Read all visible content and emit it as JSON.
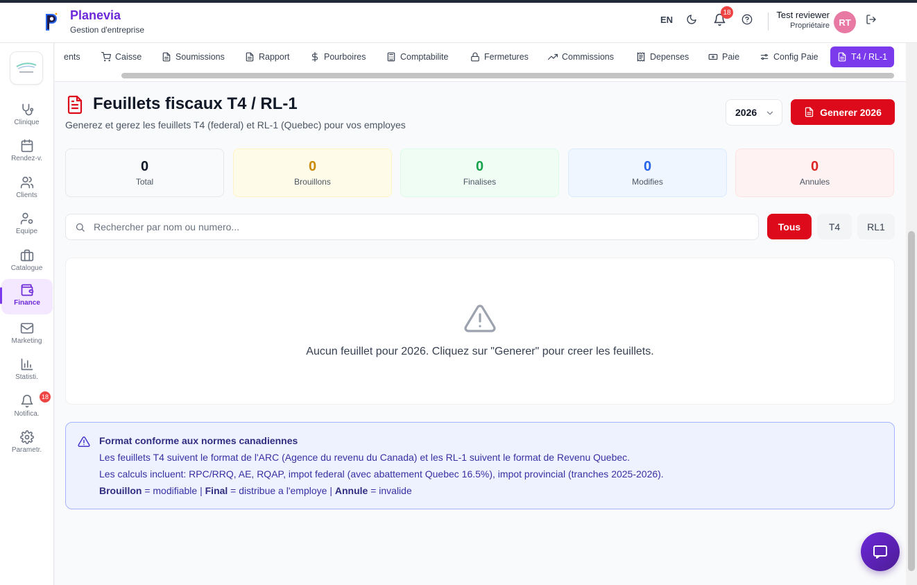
{
  "app": {
    "brand_title": "Planevia",
    "brand_subtitle": "Gestion d'entreprise",
    "accent_color": "#7c3aed",
    "danger_color": "#dc0a1a"
  },
  "header": {
    "lang": "EN",
    "notifications_count": "18",
    "user_name": "Test reviewer",
    "user_role": "Propriétaire",
    "avatar_initials": "RT"
  },
  "sidebar": {
    "items": [
      {
        "label": "Clinique",
        "icon": "stethoscope-icon"
      },
      {
        "label": "Rendez-v.",
        "icon": "calendar-icon"
      },
      {
        "label": "Clients",
        "icon": "users-icon"
      },
      {
        "label": "Equipe",
        "icon": "user-cog-icon"
      },
      {
        "label": "Catalogue",
        "icon": "briefcase-icon"
      },
      {
        "label": "Finance",
        "icon": "wallet-icon",
        "active": true
      },
      {
        "label": "Marketing",
        "icon": "mail-icon"
      },
      {
        "label": "Statisti.",
        "icon": "bar-chart-icon"
      },
      {
        "label": "Notifica.",
        "icon": "bell-icon",
        "badge": "18"
      },
      {
        "label": "Parametr.",
        "icon": "gear-icon"
      }
    ]
  },
  "tabs": [
    {
      "label": "ents",
      "icon": ""
    },
    {
      "label": "Caisse",
      "icon": "cart-icon"
    },
    {
      "label": "Soumissions",
      "icon": "file-icon"
    },
    {
      "label": "Rapport",
      "icon": "file-icon"
    },
    {
      "label": "Pourboires",
      "icon": "dollar-icon"
    },
    {
      "label": "Comptabilite",
      "icon": "calculator-icon"
    },
    {
      "label": "Fermetures",
      "icon": "lock-icon"
    },
    {
      "label": "Commissions",
      "icon": "trending-up-icon"
    },
    {
      "label": "Depenses",
      "icon": "receipt-icon"
    },
    {
      "label": "Paie",
      "icon": "banknote-icon"
    },
    {
      "label": "Config Paie",
      "icon": "sliders-icon"
    },
    {
      "label": "T4 / RL-1",
      "icon": "file-text-icon",
      "active": true
    }
  ],
  "page": {
    "title": "Feuillets fiscaux T4 / RL-1",
    "subtitle": "Generez et gerez les feuillets T4 (federal) et RL-1 (Quebec) pour vos employes",
    "year": "2026",
    "generate_label": "Generer 2026"
  },
  "stats": [
    {
      "value": "0",
      "label": "Total",
      "color": "#111827",
      "bg": "#f9fafb"
    },
    {
      "value": "0",
      "label": "Brouillons",
      "color": "#ca8a04",
      "bg": "#fefce8"
    },
    {
      "value": "0",
      "label": "Finalises",
      "color": "#16a34a",
      "bg": "#f0fdf4"
    },
    {
      "value": "0",
      "label": "Modifies",
      "color": "#2563eb",
      "bg": "#eff6ff"
    },
    {
      "value": "0",
      "label": "Annules",
      "color": "#dc2626",
      "bg": "#fef2f2"
    }
  ],
  "search": {
    "placeholder": "Rechercher par nom ou numero...",
    "value": ""
  },
  "filters": [
    {
      "label": "Tous",
      "active": true
    },
    {
      "label": "T4",
      "active": false
    },
    {
      "label": "RL1",
      "active": false
    }
  ],
  "empty_state": {
    "message": "Aucun feuillet pour 2026. Cliquez sur \"Generer\" pour creer les feuillets."
  },
  "info": {
    "title": "Format conforme aux normes canadiennes",
    "line1": "Les feuillets T4 suivent le format de l'ARC (Agence du revenu du Canada) et les RL-1 suivent le format de Revenu Quebec.",
    "line2": "Les calculs incluent: RPC/RRQ, AE, RQAP, impot federal (avec abattement Quebec 16.5%), impot provincial (tranches 2025-2026).",
    "legend": {
      "draft_term": "Brouillon",
      "draft_desc": " = modifiable | ",
      "final_term": "Final",
      "final_desc": " = distribue a l'employe | ",
      "cancel_term": "Annule",
      "cancel_desc": " = invalide"
    }
  }
}
